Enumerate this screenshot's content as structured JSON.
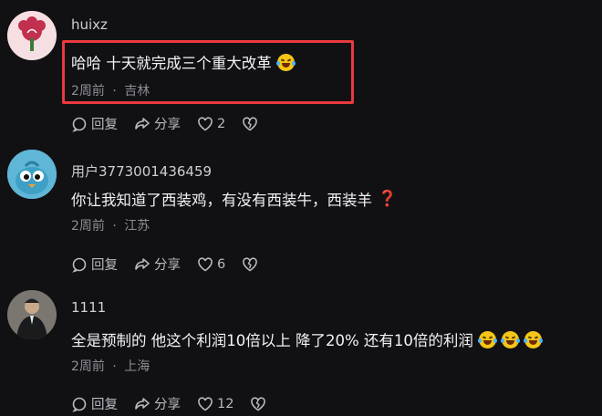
{
  "comments": [
    {
      "username": "huixz",
      "text": "哈哈 十天就完成三个重大改革",
      "emojis": [
        "laugh-cry"
      ],
      "time": "2周前",
      "location": "吉林",
      "reply_label": "回复",
      "share_label": "分享",
      "likes": "2",
      "avatar": {
        "icon": "flower-icon",
        "color": "#c2304f"
      }
    },
    {
      "username": "用户3773001436459",
      "text": "你让我知道了西装鸡，有没有西装牛，西装羊",
      "emojis": [
        "question-mark"
      ],
      "question_mark": "❓",
      "time": "2周前",
      "location": "江苏",
      "reply_label": "回复",
      "share_label": "分享",
      "likes": "6",
      "avatar": {
        "icon": "bird-icon",
        "color": "#5fb6d6"
      }
    },
    {
      "username": "1111",
      "text": "全是预制的 他这个利润10倍以上 降了20% 还有10倍的利润",
      "emojis": [
        "laugh-cry",
        "laugh-cry",
        "laugh-cry"
      ],
      "time": "2周前",
      "location": "上海",
      "reply_label": "回复",
      "share_label": "分享",
      "likes": "12",
      "avatar": {
        "icon": "person-photo-icon",
        "color": "#555555"
      }
    }
  ],
  "separator": "·",
  "highlight_color": "#ea3a3f"
}
